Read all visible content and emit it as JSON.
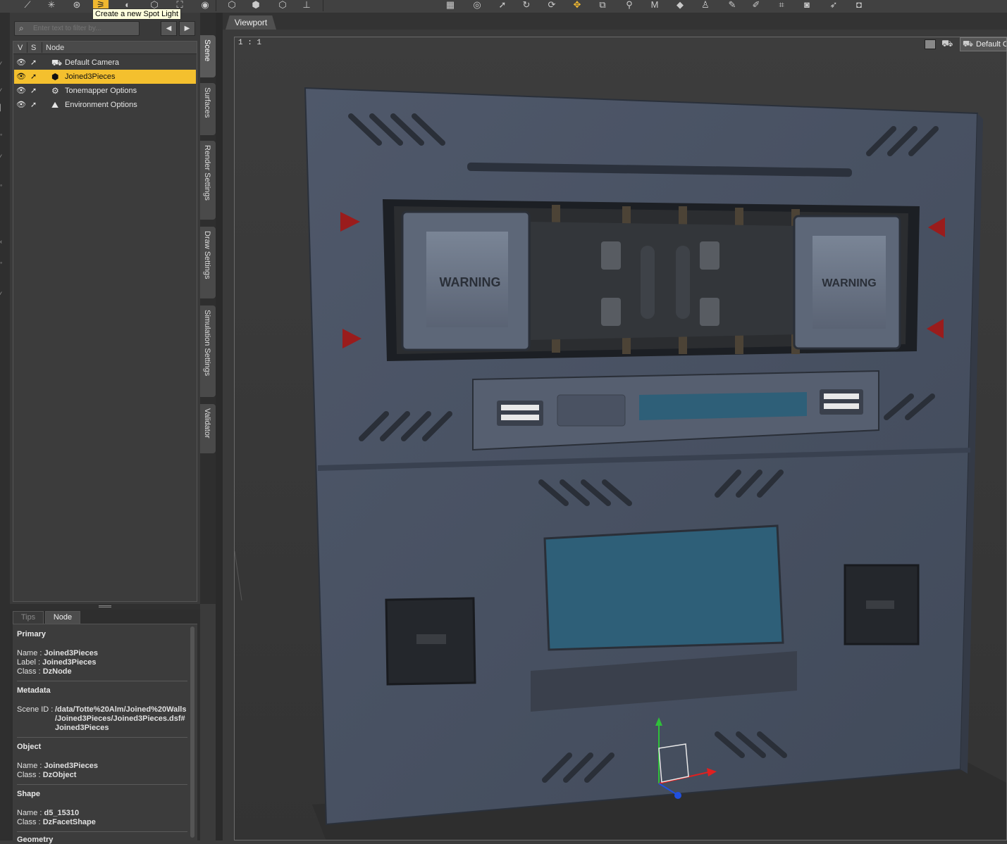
{
  "toolbar": {
    "tooltip": "Create a new Spot Light",
    "icons": [
      "wand-icon",
      "sparkle-icon",
      "compass-icon",
      "spot-light-icon",
      "point-light-icon",
      "primitive-icon",
      "node-icon",
      "info-icon",
      "cube-icon",
      "cubes-icon",
      "box-icon",
      "ruler-icon",
      "grid-icon",
      "region-icon",
      "arrow-select-icon",
      "rotate-icon",
      "rotate-alt-icon",
      "translate-icon",
      "scale-icon",
      "joint-icon",
      "morph-icon",
      "geometry-icon",
      "figure-icon",
      "tweak-icon",
      "brush-icon",
      "camera-edit-icon",
      "render-icon",
      "pointer-icon",
      "snapshot-icon"
    ]
  },
  "scene": {
    "filter_placeholder": "Enter text to filter by...",
    "columns": {
      "v": "V",
      "s": "S",
      "node": "Node"
    },
    "nodes": [
      {
        "label": "Default Camera",
        "selected": false,
        "icon": "camera-icon"
      },
      {
        "label": "Joined3Pieces",
        "selected": true,
        "icon": "box-icon"
      },
      {
        "label": "Tonemapper Options",
        "selected": false,
        "icon": "tonemapper-icon"
      },
      {
        "label": "Environment Options",
        "selected": false,
        "icon": "environment-icon"
      }
    ]
  },
  "side_tabs": [
    "Scene",
    "Surfaces",
    "Render Settings",
    "Draw Settings",
    "Simulation Settings",
    "Validator"
  ],
  "info": {
    "tabs": [
      "Tips",
      "Node"
    ],
    "active_tab": "Node",
    "primary": {
      "heading": "Primary",
      "name_key": "Name :",
      "name": "Joined3Pieces",
      "label_key": "Label :",
      "label": "Joined3Pieces",
      "class_key": "Class :",
      "class": "DzNode"
    },
    "metadata": {
      "heading": "Metadata",
      "scene_id_key": "Scene ID :",
      "scene_id_1": "/data/Totte%20Alm/Joined%20Walls",
      "scene_id_2": "/Joined3Pieces/Joined3Pieces.dsf#",
      "scene_id_3": "Joined3Pieces"
    },
    "object": {
      "heading": "Object",
      "name_key": "Name :",
      "name": "Joined3Pieces",
      "class_key": "Class :",
      "class": "DzObject"
    },
    "shape": {
      "heading": "Shape",
      "name_key": "Name :",
      "name": "d5_15310",
      "class_key": "Class :",
      "class": "DzFacetShape"
    },
    "geometry": {
      "heading": "Geometry"
    }
  },
  "viewport": {
    "tab": "Viewport",
    "ratio": "1 : 1",
    "camera": "Default Camera",
    "panel_text": "WARNING",
    "colors": {
      "panel": "#4a5466",
      "screen": "#2e5f78",
      "warning_marker": "#9a1c1c",
      "background": "#3b3b3b"
    }
  }
}
